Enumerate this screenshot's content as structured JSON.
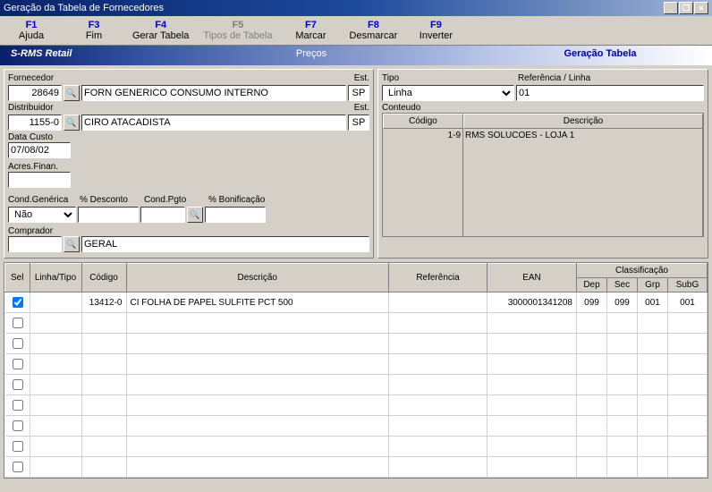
{
  "window": {
    "title": "Geração da Tabela de Fornecedores"
  },
  "toolbar": [
    {
      "key": "F1",
      "label": "Ajuda",
      "enabled": true
    },
    {
      "key": "F3",
      "label": "Fim",
      "enabled": true
    },
    {
      "key": "F4",
      "label": "Gerar Tabela",
      "enabled": true
    },
    {
      "key": "F5",
      "label": "Tipos de Tabela",
      "enabled": false
    },
    {
      "key": "F7",
      "label": "Marcar",
      "enabled": true
    },
    {
      "key": "F8",
      "label": "Desmarcar",
      "enabled": true
    },
    {
      "key": "F9",
      "label": "Inverter",
      "enabled": true
    }
  ],
  "ribbon": {
    "left": "S-RMS Retail",
    "mid": "Preços",
    "right": "Geração Tabela"
  },
  "form": {
    "fornecedor_label": "Fornecedor",
    "fornecedor_code": "28649",
    "fornecedor_name": "FORN GENERICO CONSUMO INTERNO",
    "est_label": "Est.",
    "fornecedor_est": "SP",
    "distribuidor_label": "Distribuidor",
    "distribuidor_code": "1155-0",
    "distribuidor_name": "CIRO ATACADISTA",
    "distribuidor_est": "SP",
    "data_custo_label": "Data Custo",
    "data_custo": "07/08/02",
    "acres_finan_label": "Acres.Finan.",
    "acres_finan": "",
    "cond_generica_label": "Cond.Genérica",
    "cond_generica": "Não",
    "desconto_label": "% Desconto",
    "desconto": "",
    "cond_pgto_label": "Cond.Pgto",
    "cond_pgto": "",
    "bonif_label": "% Bonificação",
    "bonif": "",
    "comprador_label": "Comprador",
    "comprador_code": "",
    "comprador_name": "GERAL",
    "tipo_label": "Tipo",
    "tipo": "Linha",
    "ref_linha_label": "Referência / Linha",
    "ref_linha": "01",
    "conteudo_label": "Conteudo",
    "conteudo_headers": {
      "codigo": "Código",
      "descricao": "Descrição"
    },
    "conteudo_row": {
      "codigo": "1-9",
      "descricao": "RMS SOLUCOES - LOJA 1"
    }
  },
  "table": {
    "headers": {
      "sel": "Sel",
      "linha_tipo": "Linha/Tipo",
      "codigo": "Código",
      "descricao": "Descrição",
      "referencia": "Referência",
      "ean": "EAN",
      "classificacao": "Classificação",
      "dep": "Dep",
      "sec": "Sec",
      "grp": "Grp",
      "subg": "SubG"
    },
    "rows": [
      {
        "sel": true,
        "linha_tipo": "",
        "codigo": "13412-0",
        "descricao": "CI FOLHA DE PAPEL SULFITE PCT 500",
        "referencia": "",
        "ean": "3000001341208",
        "dep": "099",
        "sec": "099",
        "grp": "001",
        "subg": "001"
      }
    ]
  }
}
